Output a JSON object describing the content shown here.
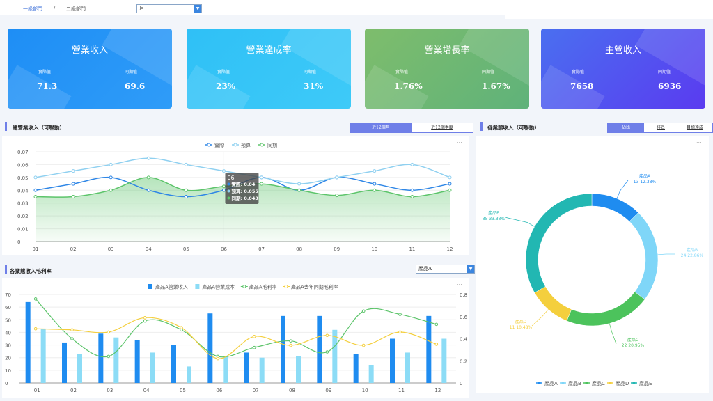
{
  "breadcrumb": {
    "level1": "一級部門",
    "separator": "/",
    "level2": "二級部門"
  },
  "period_select": {
    "value": "月"
  },
  "kpis": [
    {
      "title": "營業收入",
      "actual_label": "實際值",
      "prior_label": "同期值",
      "actual": "71.3",
      "prior": "69.6",
      "color1": "#1e8ef5",
      "color2": "#2f9cf8"
    },
    {
      "title": "營業達成率",
      "actual_label": "實際值",
      "prior_label": "同期值",
      "actual": "23%",
      "prior": "31%",
      "color1": "#2fc0f6",
      "color2": "#3ecaf8"
    },
    {
      "title": "營業增長率",
      "actual_label": "實際值",
      "prior_label": "同期值",
      "actual": "1.76%",
      "prior": "1.67%",
      "color1": "#7ebd6c",
      "color2": "#5fb27a"
    },
    {
      "title": "主營收入",
      "actual_label": "實際值",
      "prior_label": "同期值",
      "actual": "7658",
      "prior": "6936",
      "color1": "#4a6ff0",
      "color2": "#5a3bf0"
    }
  ],
  "revenue_section": {
    "title": "總營業收入（可聯動）",
    "tabs": [
      "近12個月",
      "近12個季度"
    ],
    "active_tab": 0,
    "more": "···"
  },
  "margin_section": {
    "title": "各業態收入毛利率",
    "select_value": "產品A",
    "more": "···"
  },
  "format_section": {
    "title": "各業態收入（可聯動）",
    "tabs": [
      "佔比",
      "排名",
      "目標達成"
    ],
    "active_tab": 0,
    "more": "···"
  },
  "tooltip": {
    "title": "06",
    "rows": [
      "實際: 0.04",
      "預算: 0.055",
      "同期: 0.043"
    ]
  },
  "chart_data": [
    {
      "type": "line",
      "categories": [
        "01",
        "02",
        "03",
        "04",
        "05",
        "06",
        "07",
        "08",
        "09",
        "10",
        "11",
        "12"
      ],
      "series": [
        {
          "name": "實際",
          "values": [
            0.04,
            0.045,
            0.05,
            0.04,
            0.035,
            0.04,
            0.05,
            0.04,
            0.05,
            0.045,
            0.04,
            0.045
          ],
          "color": "#2e86e6"
        },
        {
          "name": "預算",
          "values": [
            0.05,
            0.055,
            0.06,
            0.065,
            0.06,
            0.055,
            0.05,
            0.045,
            0.05,
            0.055,
            0.06,
            0.05
          ],
          "color": "#8fd0f0"
        },
        {
          "name": "同期",
          "values": [
            0.035,
            0.035,
            0.04,
            0.05,
            0.04,
            0.043,
            0.045,
            0.04,
            0.036,
            0.04,
            0.035,
            0.04
          ],
          "color": "#5cc46a"
        }
      ],
      "yticks": [
        "0",
        "0.01",
        "0.02",
        "0.03",
        "0.04",
        "0.05",
        "0.06",
        "0.07"
      ],
      "ylim": [
        0,
        0.07
      ],
      "grid": true,
      "legend_position": "top-center"
    },
    {
      "type": "bar",
      "categories": [
        "01",
        "02",
        "03",
        "04",
        "05",
        "06",
        "07",
        "08",
        "09",
        "10",
        "11",
        "12"
      ],
      "series": [
        {
          "name": "產品A營業收入",
          "kind": "bar",
          "axis": "left",
          "values": [
            64,
            32,
            39,
            34,
            30,
            55,
            24,
            53,
            53,
            23,
            35,
            53
          ],
          "color": "#1f8cf0"
        },
        {
          "name": "產品A營業成本",
          "kind": "bar",
          "axis": "left",
          "values": [
            43,
            23,
            36,
            24,
            13,
            21,
            20,
            21,
            42,
            14,
            24,
            35
          ],
          "color": "#8cdcf6"
        },
        {
          "name": "產品A毛利率",
          "kind": "line",
          "axis": "right",
          "values": [
            0.76,
            0.4,
            0.24,
            0.56,
            0.48,
            0.24,
            0.32,
            0.38,
            0.28,
            0.65,
            0.62,
            0.53
          ],
          "color": "#5cc46a"
        },
        {
          "name": "產品A去年同期毛利率",
          "kind": "line",
          "axis": "right",
          "values": [
            0.49,
            0.48,
            0.46,
            0.59,
            0.5,
            0.22,
            0.42,
            0.34,
            0.43,
            0.34,
            0.46,
            0.35
          ],
          "color": "#f4cf3d"
        }
      ],
      "yticks_left": [
        "0",
        "10",
        "20",
        "30",
        "40",
        "50",
        "60",
        "70"
      ],
      "yticks_right": [
        "0",
        "0.2",
        "0.4",
        "0.6",
        "0.8"
      ],
      "ylim_left": [
        0,
        70
      ],
      "ylim_right": [
        0,
        0.8
      ],
      "legend_position": "top-center"
    },
    {
      "type": "pie",
      "donut": true,
      "slices": [
        {
          "name": "產品A",
          "value": 13,
          "pct": "12.38%",
          "color": "#1f8cf0"
        },
        {
          "name": "產品B",
          "value": 24,
          "pct": "22.86%",
          "color": "#7fd6f8"
        },
        {
          "name": "產品C",
          "value": 22,
          "pct": "20.95%",
          "color": "#4cc35c"
        },
        {
          "name": "產品D",
          "value": 11,
          "pct": "10.48%",
          "color": "#f4cf3d"
        },
        {
          "name": "產品E",
          "value": 35,
          "pct": "33.33%",
          "color": "#22b7b2"
        }
      ],
      "legend_position": "bottom-center"
    }
  ]
}
